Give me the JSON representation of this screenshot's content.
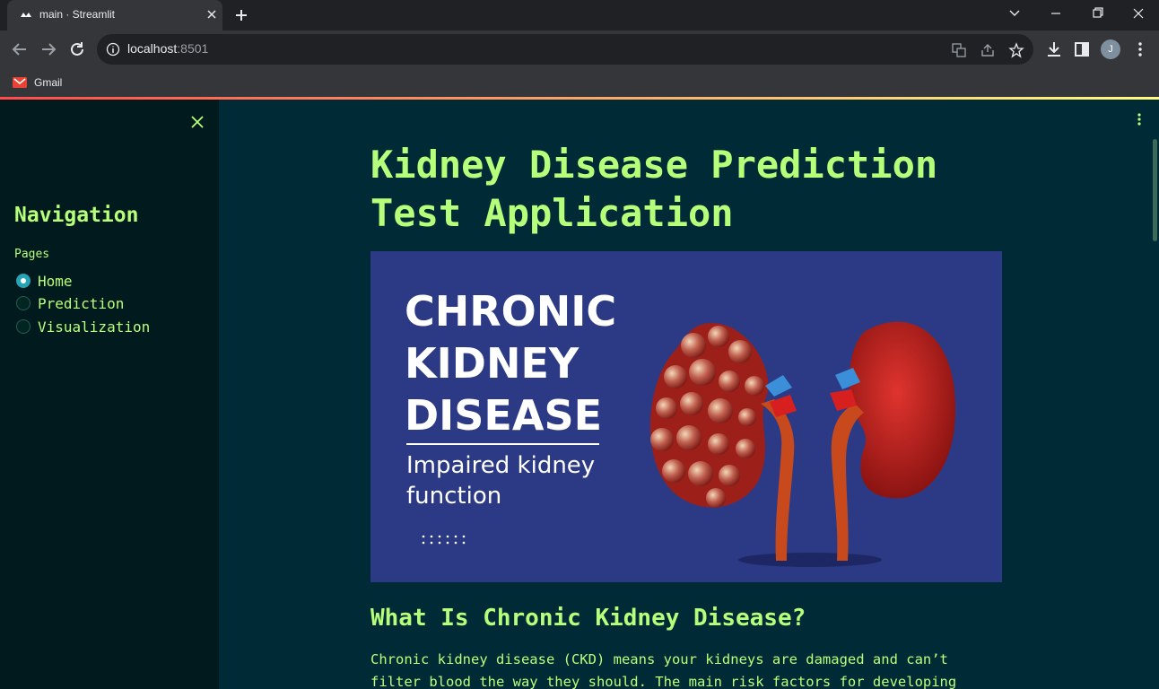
{
  "browser": {
    "tab_title": "main · Streamlit",
    "url_host": "localhost",
    "url_port": ":8501",
    "avatar_initial": "J",
    "bookmarks": [
      {
        "label": "Gmail",
        "icon": "gmail-icon"
      }
    ]
  },
  "sidebar": {
    "title": "Navigation",
    "pages_label": "Pages",
    "pages": [
      {
        "label": "Home",
        "selected": true
      },
      {
        "label": "Prediction",
        "selected": false
      },
      {
        "label": "Visualization",
        "selected": false
      }
    ]
  },
  "main": {
    "title": "Kidney Disease Prediction Test Application",
    "banner": {
      "line1": "CHRONIC",
      "line2": "KIDNEY",
      "line3": "DISEASE",
      "sub1": "Impaired kidney",
      "sub2": "function"
    },
    "heading": "What Is Chronic Kidney Disease?",
    "paragraph": "Chronic kidney disease (CKD) means your kidneys are damaged and can’t filter blood the way they should. The main risk factors for developing"
  },
  "colors": {
    "accent_text": "#b6ff7a",
    "app_bg": "#002b36",
    "sidebar_bg": "#011a1e",
    "banner_bg": "#2c3a85",
    "radio_selected": "#26a3b5"
  }
}
